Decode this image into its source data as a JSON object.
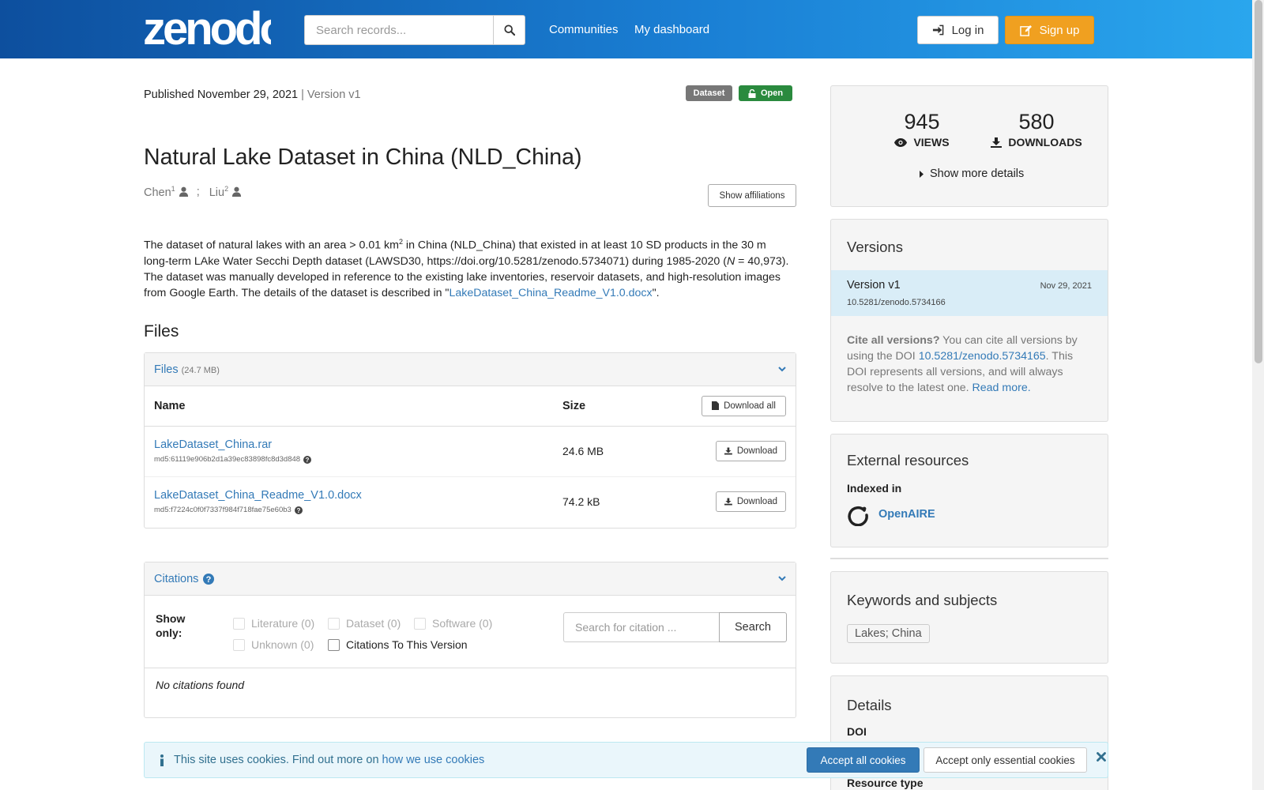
{
  "header": {
    "logo_text": "zenodo",
    "search_placeholder": "Search records...",
    "nav": [
      "Communities",
      "My dashboard"
    ],
    "login_label": "Log in",
    "signup_label": "Sign up"
  },
  "record": {
    "published": "Published November 29, 2021",
    "version": "| Version v1",
    "badge_type": "Dataset",
    "badge_access": "Open",
    "title": "Natural Lake Dataset in China (NLD_China)",
    "authors": [
      {
        "name": "Chen",
        "sup": "1"
      },
      {
        "name": "Liu",
        "sup": "2"
      }
    ],
    "author_separator": ";",
    "show_affiliations_label": "Show affiliations",
    "description": {
      "p1": "The dataset of natural lakes with an area > 0.01 km",
      "p1_sup": "2",
      "p2": " in China (NLD_China) that existed in at least 10 SD products in the 30 m long-term LAke Water Secchi Depth dataset (LAWSD30, https://doi.org/10.5281/zenodo.5734071) during 1985-2020 (",
      "p2_italic": "N",
      "p3": " = 40,973). The dataset was manually developed in reference to the existing lake inventories, reservoir datasets, and high-resolution images from Google Earth. The details of the dataset is described in \"",
      "link": "LakeDataset_China_Readme_V1.0.docx",
      "p4": "\"."
    }
  },
  "files": {
    "section_title": "Files",
    "panel_label": "Files",
    "total_size": "(24.7 MB)",
    "col_name": "Name",
    "col_size": "Size",
    "download_all_label": "Download all",
    "download_label": "Download",
    "items": [
      {
        "name": "LakeDataset_China.rar",
        "md5": "md5:61119e906b2d1a39ec83898fc8d3d848",
        "size": "24.6 MB"
      },
      {
        "name": "LakeDataset_China_Readme_V1.0.docx",
        "md5": "md5:f7224c0f0f7337f984f718fae75e60b3",
        "size": "74.2 kB"
      }
    ]
  },
  "citations": {
    "panel_label": "Citations",
    "show_only": "Show only:",
    "filters": [
      {
        "label": "Literature (0)",
        "active": false
      },
      {
        "label": "Dataset (0)",
        "active": false
      },
      {
        "label": "Software (0)",
        "active": false
      },
      {
        "label": "Unknown (0)",
        "active": false
      },
      {
        "label": "Citations To This Version",
        "active": true
      }
    ],
    "search_placeholder": "Search for citation ...",
    "search_label": "Search",
    "empty": "No citations found"
  },
  "stats": {
    "views": "945",
    "views_label": "VIEWS",
    "downloads": "580",
    "downloads_label": "DOWNLOADS",
    "more_details": "Show more details"
  },
  "versions": {
    "title": "Versions",
    "current_label": "Version v1",
    "current_date": "Nov 29, 2021",
    "current_doi": "10.5281/zenodo.5734166",
    "cite_bold": "Cite all versions?",
    "cite_text1": " You can cite all versions by using the DOI ",
    "cite_doi": "10.5281/zenodo.5734165",
    "cite_text2": ". This DOI represents all versions, and will always resolve to the latest one. ",
    "read_more": "Read more."
  },
  "external": {
    "title": "External resources",
    "indexed_in": "Indexed in",
    "openaire": "OpenAIRE"
  },
  "keywords": {
    "title": "Keywords and subjects",
    "tag": "Lakes; China"
  },
  "details": {
    "title": "Details",
    "doi_label": "DOI",
    "resource_type_label": "Resource type"
  },
  "cookie": {
    "text": "This site uses cookies. Find out more on ",
    "link": "how we use cookies",
    "accept_all": "Accept all cookies",
    "accept_essential": "Accept only essential cookies"
  },
  "colors": {
    "accent": "#337ab7",
    "signup": "#f0a020",
    "open_badge": "#2a8a3e",
    "header_start": "#0d4f9e",
    "header_end": "#2aa7ee"
  }
}
